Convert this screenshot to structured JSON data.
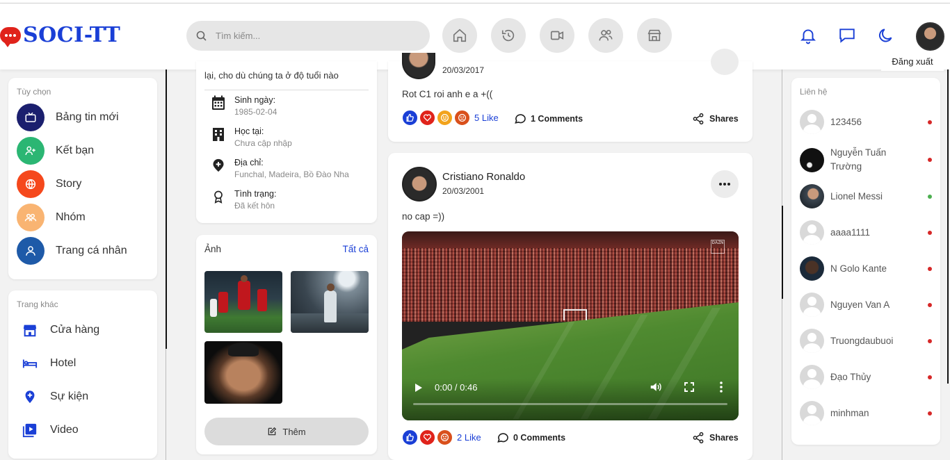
{
  "app": {
    "logo_text": "SOCI-TT"
  },
  "search": {
    "placeholder": "Tìm kiếm..."
  },
  "header": {
    "logout_label": "Đăng xuất"
  },
  "left_menu": {
    "title": "Tùy chọn",
    "items": [
      {
        "label": "Bảng tin mới",
        "icon": "tv-icon",
        "color": "#1b1f6e"
      },
      {
        "label": "Kết bạn",
        "icon": "add-user-icon",
        "color": "#2bb673"
      },
      {
        "label": "Story",
        "icon": "globe-icon",
        "color": "#f5481c"
      },
      {
        "label": "Nhóm",
        "icon": "group-icon",
        "color": "#f9b472"
      },
      {
        "label": "Trang cá nhân",
        "icon": "user-icon",
        "color": "#1e5aa8"
      }
    ]
  },
  "other_pages": {
    "title": "Trang khác",
    "items": [
      {
        "label": "Cửa hàng",
        "icon": "store-icon"
      },
      {
        "label": "Hotel",
        "icon": "bed-icon"
      },
      {
        "label": "Sự kiện",
        "icon": "map-pin-icon"
      },
      {
        "label": "Video",
        "icon": "video-play-icon"
      }
    ]
  },
  "profile": {
    "bio_tail": "lại, cho dù chúng ta ở độ tuổi nào",
    "birthday_label": "Sinh ngày:",
    "birthday": "1985-02-04",
    "school_label": "Học tại:",
    "school": "Chưa cập nhập",
    "address_label": "Địa chỉ:",
    "address": "Funchal, Madeira, Bồ Đào Nha",
    "status_label": "Tình trạng:",
    "status": "Đã kết hôn"
  },
  "photos": {
    "title": "Ảnh",
    "see_all": "Tất cả",
    "more_button": "Thêm"
  },
  "posts": [
    {
      "date": "20/03/2017",
      "text": "Rot C1 roi anh e a +((",
      "likes": "5 Like",
      "comments": "1 Comments",
      "shares": "Shares"
    },
    {
      "author": "Cristiano Ronaldo",
      "date": "20/03/2001",
      "text": "no cap =))",
      "video_time": "0:00 / 0:46",
      "video_watermark": "DAZN",
      "likes": "2 Like",
      "comments": "0 Comments",
      "shares": "Shares"
    }
  ],
  "contacts": {
    "title": "Liên hệ",
    "items": [
      {
        "name": "123456",
        "status_color": "#d62828"
      },
      {
        "name": "Nguyễn Tuấn Trường",
        "status_color": "#d62828"
      },
      {
        "name": "Lionel Messi",
        "status_color": "#4caf50"
      },
      {
        "name": "aaaa1111",
        "status_color": "#d62828"
      },
      {
        "name": "N Golo Kante",
        "status_color": "#d62828"
      },
      {
        "name": "Nguyen Van A",
        "status_color": "#d62828"
      },
      {
        "name": "Truongdaubuoi",
        "status_color": "#d62828"
      },
      {
        "name": "Đạo Thủy",
        "status_color": "#d62828"
      },
      {
        "name": "minhman",
        "status_color": "#d62828"
      }
    ]
  },
  "colors": {
    "brand": "#1a3fd6",
    "accent_red": "#e0231b"
  }
}
